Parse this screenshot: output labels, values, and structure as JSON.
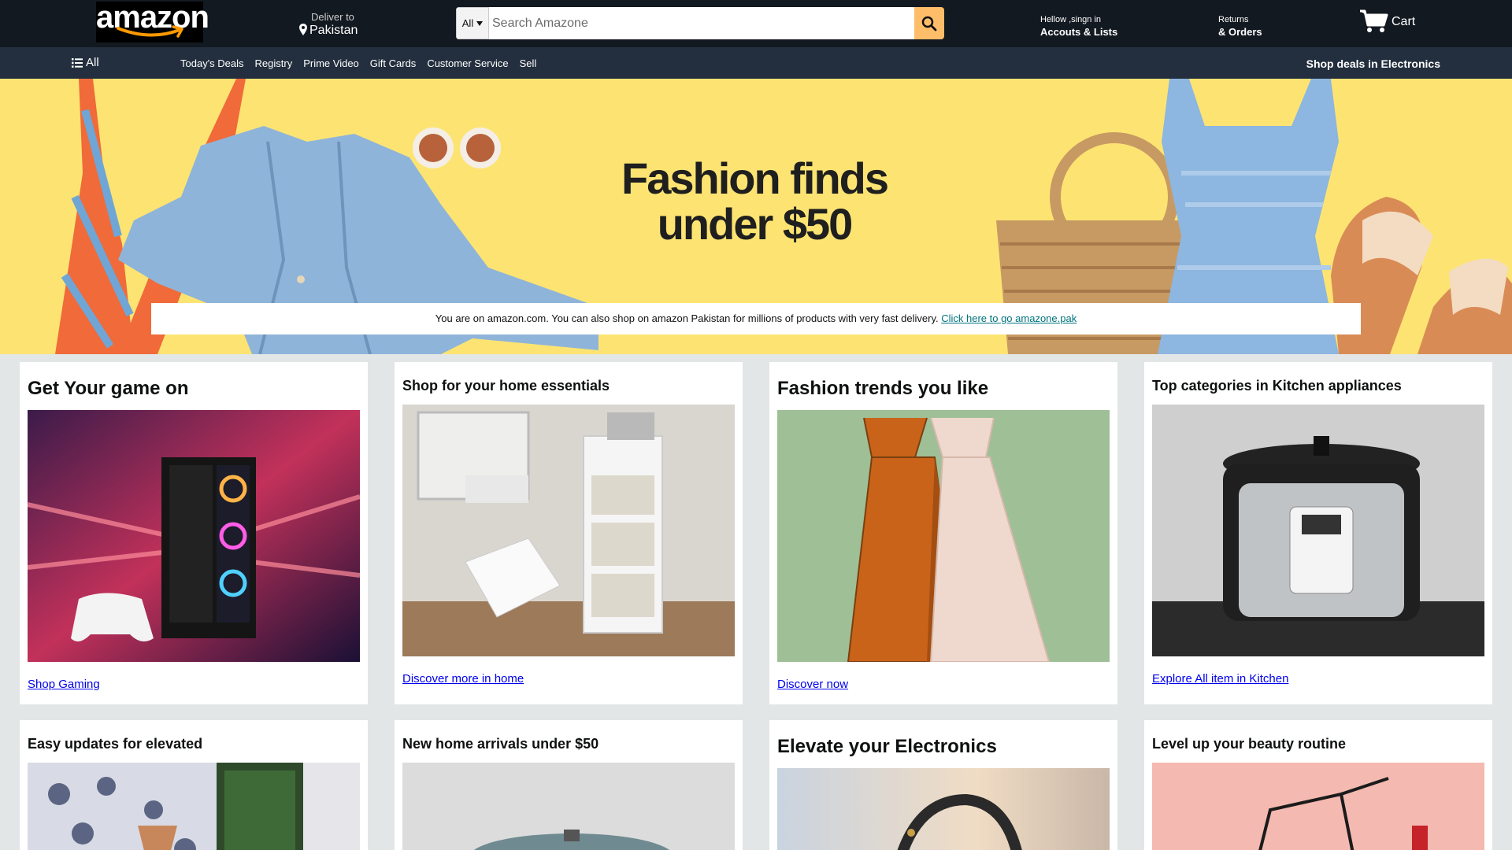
{
  "brand": {
    "logo_text": "amazon"
  },
  "deliver": {
    "label": "Deliver to",
    "location": "Pakistan"
  },
  "search": {
    "category": "All",
    "placeholder": "Search Amazone"
  },
  "account": {
    "greeting": "Hellow ,singn in",
    "label": "Accouts & Lists"
  },
  "returns": {
    "line1": "Returns",
    "line2": "& Orders"
  },
  "cart": {
    "label": "Cart"
  },
  "subnav": {
    "all_label": "All",
    "links": [
      "Today's Deals",
      "Registry",
      "Prime Video",
      "Gift Cards",
      "Customer Service",
      "Sell"
    ],
    "promo": "Shop deals in Electronics"
  },
  "hero": {
    "title_line1": "Fashion finds",
    "title_line2": "under $50",
    "notice_text": "You are on amazon.com. You can also shop on amazon Pakistan for millions of products with very fast delivery.",
    "notice_link": "Click here to go amazone.pak"
  },
  "cards": [
    {
      "title": "Get Your game on",
      "link": "Shop Gaming"
    },
    {
      "title": "Shop for your home essentials",
      "link": "Discover more in home"
    },
    {
      "title": "Fashion trends you like",
      "link": "Discover now"
    },
    {
      "title": "Top categories in Kitchen appliances",
      "link": "Explore All item in Kitchen"
    },
    {
      "title": "Easy updates for elevated"
    },
    {
      "title": "New home arrivals under $50"
    },
    {
      "title": "Elevate your Electronics"
    },
    {
      "title": "Level up your beauty routine"
    }
  ],
  "colors": {
    "nav_dark": "#131921",
    "nav_sub": "#232f3e",
    "search_button": "#febd69",
    "hero_bg": "#fde472",
    "link_blue": "#0000ee",
    "notice_link": "#00737e"
  },
  "icons": [
    "location-pin-icon",
    "caret-down-icon",
    "search-icon",
    "cart-icon",
    "menu-icon"
  ]
}
